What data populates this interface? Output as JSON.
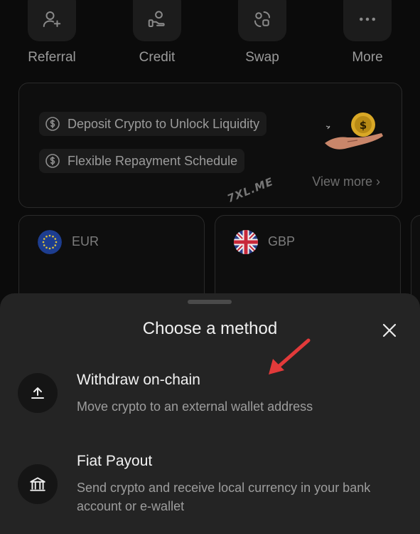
{
  "quick_actions": [
    {
      "label": "Referral",
      "icon": "add-user-icon"
    },
    {
      "label": "Credit",
      "icon": "credit-hand-icon"
    },
    {
      "label": "Swap",
      "icon": "swap-icon"
    },
    {
      "label": "More",
      "icon": "more-icon"
    }
  ],
  "promo": {
    "items": [
      {
        "text": "Deposit Crypto to Unlock Liquidity",
        "icon": "dollar-cycle-icon"
      },
      {
        "text": "Flexible Repayment Schedule",
        "icon": "dollar-cycle-icon"
      }
    ],
    "view_more": "View more ›",
    "illustration": "hand-coin-icon"
  },
  "watermark": "7XL.ME",
  "currencies": [
    {
      "code": "EUR",
      "flag": "eu-flag-icon"
    },
    {
      "code": "GBP",
      "flag": "uk-flag-icon"
    }
  ],
  "sheet": {
    "title": "Choose a method",
    "close_icon": "close-icon",
    "methods": [
      {
        "title": "Withdraw on-chain",
        "description": "Move crypto to an external wallet address",
        "icon": "upload-icon"
      },
      {
        "title": "Fiat Payout",
        "description": "Send crypto and receive local currency in your bank account or e-wallet",
        "icon": "bank-icon"
      }
    ]
  },
  "colors": {
    "background": "#0b0b0b",
    "sheet": "#242424",
    "annotation_arrow": "#e23a3a",
    "coin": "#d9a826"
  }
}
